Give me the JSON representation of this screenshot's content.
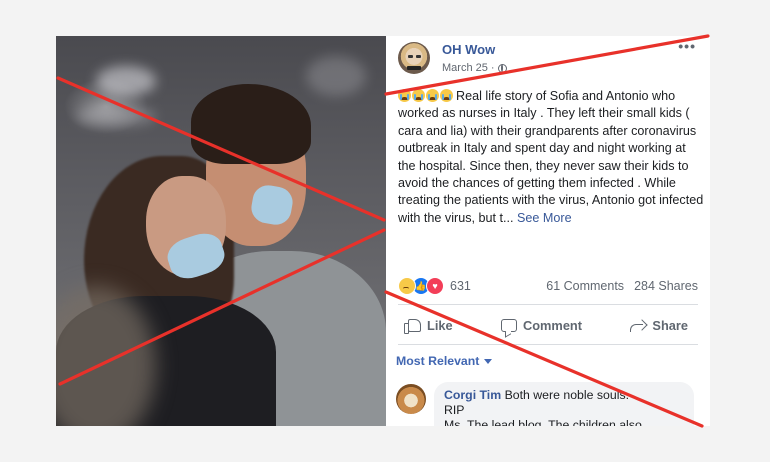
{
  "post": {
    "author": "OH Wow",
    "date": "March 25",
    "more_label": "•••",
    "body": "Real life story of Sofia and Antonio who worked as nurses in Italy . They left their small kids ( cara and lia) with their grandparents after coronavirus outbreak in Italy and spent day and night working at the hospital. Since then, they never saw their kids to avoid the chances of getting them infected . While treating the patients with the virus, Antonio got infected with the virus, but t...",
    "see_more": "See More",
    "reaction_count": "631",
    "comments_count": "61 Comments",
    "shares_count": "284 Shares",
    "actions": {
      "like": "Like",
      "comment": "Comment",
      "share": "Share"
    },
    "sort_label": "Most Relevant",
    "comment": {
      "author": "Corgi Tim",
      "text": "Both were noble souls.",
      "text2": "RIP",
      "text3": "Ms. The lead blog. The children also"
    }
  },
  "icons": [
    "globe-icon",
    "sad-emoji-icon",
    "like-reaction-icon",
    "love-reaction-icon",
    "thumbs-up-icon",
    "comment-bubble-icon",
    "share-arrow-icon",
    "caret-down-icon"
  ],
  "colors": {
    "link": "#385898",
    "cross": "#e8312a",
    "muted": "#606770"
  }
}
